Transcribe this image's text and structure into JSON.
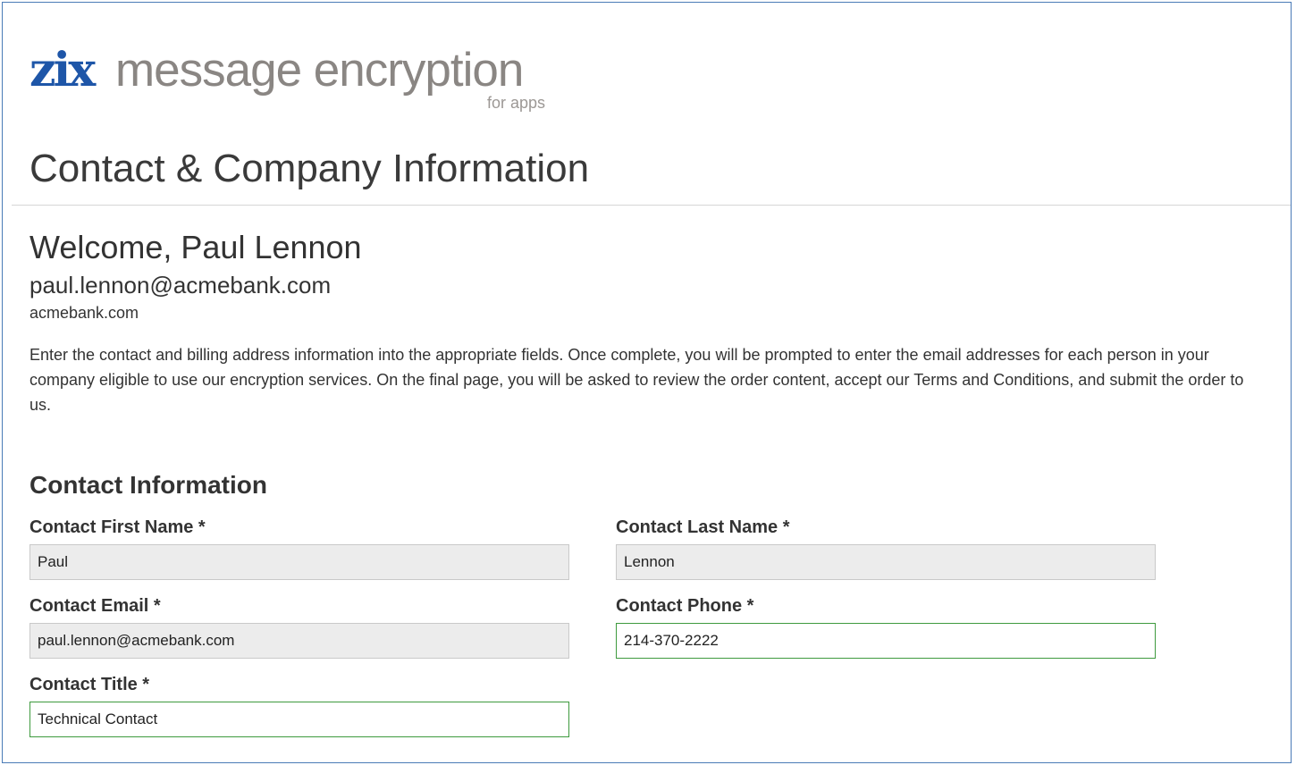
{
  "brand": {
    "logo_mark": "zix",
    "product_name": "message encryption",
    "product_sub": "for apps"
  },
  "page_title": "Contact & Company Information",
  "welcome": {
    "greeting": "Welcome, Paul Lennon",
    "email": "paul.lennon@acmebank.com",
    "domain": "acmebank.com"
  },
  "instructions": "Enter the contact and billing address information into the appropriate fields. Once complete, you will be prompted to enter the email addresses for each person in your company eligible to use our encryption services. On the final page, you will be asked to review the order content, accept our Terms and Conditions, and submit the order to us.",
  "contact_section": {
    "title": "Contact Information",
    "first_name": {
      "label": "Contact First Name *",
      "value": "Paul"
    },
    "last_name": {
      "label": "Contact Last Name *",
      "value": "Lennon"
    },
    "email": {
      "label": "Contact Email *",
      "value": "paul.lennon@acmebank.com"
    },
    "phone": {
      "label": "Contact Phone *",
      "value": "214-370-2222"
    },
    "title_field": {
      "label": "Contact Title *",
      "value": "Technical Contact"
    }
  },
  "colors": {
    "brand_blue": "#1e56a8",
    "brand_gray": "#8a8683",
    "frame_border": "#4a7bb7",
    "editable_border": "#3e9a3e",
    "readonly_background": "#ececec"
  }
}
